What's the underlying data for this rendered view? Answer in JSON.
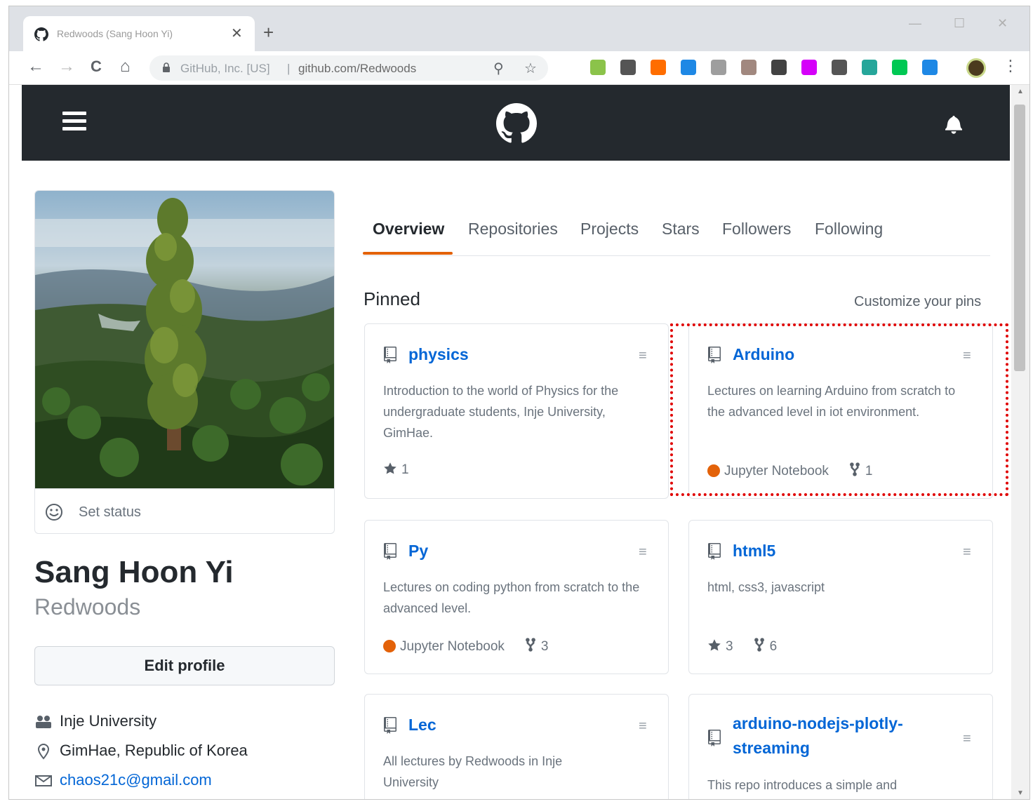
{
  "browser": {
    "tab_title": "Redwoods (Sang Hoon Yi)",
    "close_glyph": "✕",
    "newtab_glyph": "+",
    "win_min": "—",
    "win_max": "☐",
    "win_close": "✕",
    "back_glyph": "←",
    "forward_glyph": "→",
    "reload_glyph": "C",
    "home_glyph": "⌂",
    "site_identity": "GitHub, Inc. [US]",
    "url": "github.com/Redwoods",
    "zoom_glyph": "⚲",
    "star_glyph": "☆",
    "menu_glyph": "⋮",
    "extensions": [
      "#8bc34a",
      "#555555",
      "#ff6d00",
      "#1e88e5",
      "#9e9e9e",
      "#a1887f",
      "#424242",
      "#d500f9",
      "#555555",
      "#26a69a",
      "#00c853",
      "#1e88e5"
    ]
  },
  "header": {
    "colors": {
      "bg": "#24292e"
    }
  },
  "profile": {
    "set_status": "Set status",
    "full_name": "Sang Hoon Yi",
    "username": "Redwoods",
    "edit_profile": "Edit profile",
    "organization": "Inje University",
    "location": "GimHae, Republic of Korea",
    "email": "chaos21c@gmail.com"
  },
  "tabs": [
    "Overview",
    "Repositories",
    "Projects",
    "Stars",
    "Followers",
    "Following"
  ],
  "pinned": {
    "title": "Pinned",
    "customize": "Customize your pins",
    "cards": [
      {
        "name": "physics",
        "description": "Introduction to the world of Physics for the undergraduate students, Inje University, GimHae.",
        "stars": "1"
      },
      {
        "name": "Arduino",
        "description": "Lectures on learning Arduino from scratch to the advanced level in iot environment.",
        "language": "Jupyter Notebook",
        "language_color": "#e36209",
        "forks": "1"
      },
      {
        "name": "Py",
        "description": "Lectures on coding python from scratch to the advanced level.",
        "language": "Jupyter Notebook",
        "language_color": "#e36209",
        "forks": "3"
      },
      {
        "name": "html5",
        "description": "html, css3, javascript",
        "stars": "3",
        "forks": "6"
      },
      {
        "name": "Lec",
        "description": "All lectures by Redwoods in Inje University"
      },
      {
        "name": "arduino-nodejs-plotly-streaming",
        "description": "This repo introduces a simple and"
      }
    ]
  }
}
